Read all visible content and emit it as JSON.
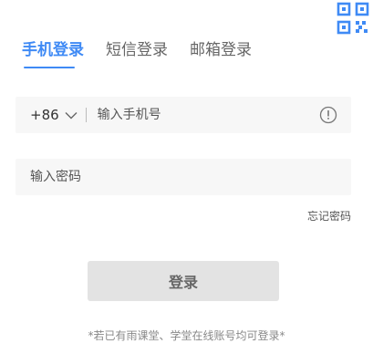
{
  "tabs": [
    {
      "label": "手机登录",
      "active": true
    },
    {
      "label": "短信登录",
      "active": false
    },
    {
      "label": "邮箱登录",
      "active": false
    }
  ],
  "phone": {
    "country_code": "+86",
    "placeholder": "输入手机号",
    "value": ""
  },
  "password": {
    "placeholder": "输入密码",
    "value": ""
  },
  "forgot_label": "忘记密码",
  "login_label": "登录",
  "footer_note": "*若已有雨课堂、学堂在线账号均可登录*",
  "colors": {
    "accent": "#3f8af5",
    "field_bg": "#f7f7f7",
    "button_bg": "#e3e3e3"
  },
  "icons": {
    "qr": "qr-code-icon",
    "dropdown": "chevron-down-icon",
    "info": "info-icon"
  }
}
